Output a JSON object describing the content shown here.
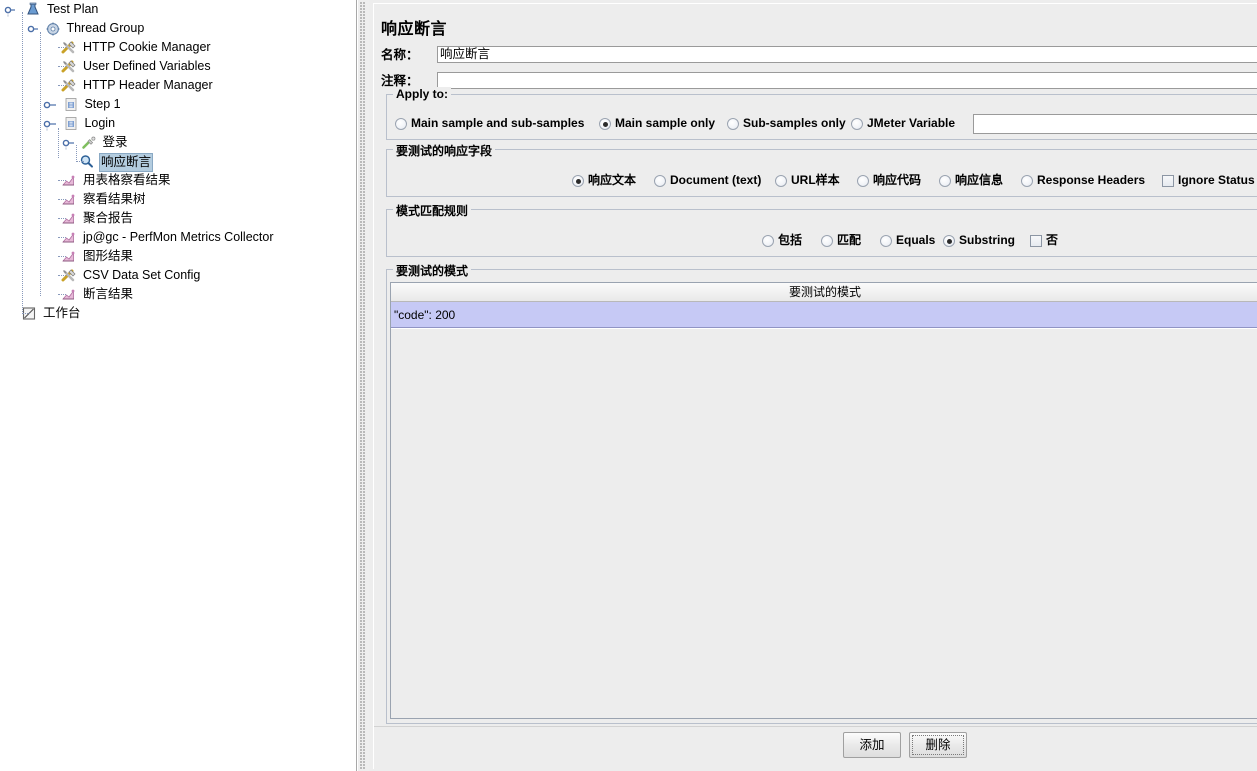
{
  "tree": {
    "items": [
      {
        "label": "Test Plan",
        "icon": "test-plan-icon",
        "depth": 0,
        "handle": "expanded",
        "selected": false
      },
      {
        "label": "Thread Group",
        "icon": "thread-group-icon",
        "depth": 1,
        "handle": "expanded",
        "selected": false
      },
      {
        "label": "HTTP Cookie Manager",
        "icon": "config-icon",
        "depth": 2,
        "handle": "none",
        "selected": false
      },
      {
        "label": "User Defined Variables",
        "icon": "config-icon",
        "depth": 2,
        "handle": "none",
        "selected": false
      },
      {
        "label": "HTTP Header Manager",
        "icon": "config-icon",
        "depth": 2,
        "handle": "none",
        "selected": false
      },
      {
        "label": "Step 1",
        "icon": "controller-icon",
        "depth": 2,
        "handle": "collapsed",
        "selected": false
      },
      {
        "label": "Login",
        "icon": "controller-icon",
        "depth": 2,
        "handle": "expanded",
        "selected": false
      },
      {
        "label": "登录",
        "icon": "sampler-icon",
        "depth": 3,
        "handle": "expanded",
        "selected": false
      },
      {
        "label": "响应断言",
        "icon": "assertion-icon",
        "depth": 4,
        "handle": "none",
        "selected": true
      },
      {
        "label": "用表格察看结果",
        "icon": "listener-icon",
        "depth": 2,
        "handle": "none",
        "selected": false
      },
      {
        "label": "察看结果树",
        "icon": "listener-icon",
        "depth": 2,
        "handle": "none",
        "selected": false
      },
      {
        "label": "聚合报告",
        "icon": "listener-icon",
        "depth": 2,
        "handle": "none",
        "selected": false
      },
      {
        "label": "jp@gc - PerfMon Metrics Collector",
        "icon": "listener-icon",
        "depth": 2,
        "handle": "none",
        "selected": false
      },
      {
        "label": "图形结果",
        "icon": "listener-icon",
        "depth": 2,
        "handle": "none",
        "selected": false
      },
      {
        "label": "CSV Data Set Config",
        "icon": "config-icon",
        "depth": 2,
        "handle": "none",
        "selected": false
      },
      {
        "label": "断言结果",
        "icon": "listener-icon",
        "depth": 2,
        "handle": "none",
        "selected": false
      },
      {
        "label": "工作台",
        "icon": "workbench-icon",
        "depth": 0,
        "handle": "none",
        "selected": false
      }
    ]
  },
  "panel": {
    "title": "响应断言",
    "name_label": "名称：",
    "name_value": "响应断言",
    "comment_label": "注释：",
    "comment_value": ""
  },
  "apply_to": {
    "title": "Apply to:",
    "options": [
      {
        "label": "Main sample and sub-samples",
        "selected": false
      },
      {
        "label": "Main sample only",
        "selected": true
      },
      {
        "label": "Sub-samples only",
        "selected": false
      },
      {
        "label": "JMeter Variable",
        "selected": false
      }
    ],
    "variable_value": ""
  },
  "response_field": {
    "title": "要测试的响应字段",
    "options": [
      {
        "label": "响应文本",
        "selected": true
      },
      {
        "label": "Document (text)",
        "selected": false
      },
      {
        "label": "URL样本",
        "selected": false
      },
      {
        "label": "响应代码",
        "selected": false
      },
      {
        "label": "响应信息",
        "selected": false
      },
      {
        "label": "Response Headers",
        "selected": false
      }
    ],
    "ignore_status": {
      "label": "Ignore Status",
      "checked": false
    }
  },
  "pattern_rules": {
    "title": "模式匹配规则",
    "options": [
      {
        "label": "包括",
        "selected": false
      },
      {
        "label": "匹配",
        "selected": false
      },
      {
        "label": "Equals",
        "selected": false
      },
      {
        "label": "Substring",
        "selected": true
      }
    ],
    "negate": {
      "label": "否",
      "checked": false
    }
  },
  "patterns": {
    "title": "要测试的模式",
    "column_header": "要测试的模式",
    "rows": [
      {
        "value": "\"code\": 200",
        "selected": true
      }
    ]
  },
  "buttons": {
    "add": "添加",
    "delete": "删除",
    "focused": "delete"
  },
  "colors": {
    "panel_bg": "#ededed",
    "tree_selection": "#b3ccdf",
    "table_selection": "#c6c9f5",
    "group_border": "#b9c0cc"
  }
}
